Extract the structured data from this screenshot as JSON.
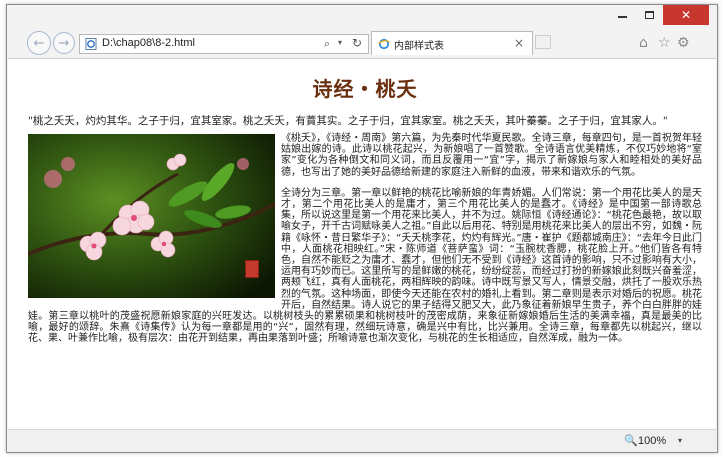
{
  "window": {
    "controls": {
      "minimize": "–",
      "maximize": "□",
      "close": "✕"
    }
  },
  "navigation": {
    "back_icon": "←",
    "forward_icon": "→",
    "address": "D:\\chap08\\8-2.html",
    "search_icon": "⌕",
    "dropdown_icon": "▾",
    "refresh_icon": "↻"
  },
  "tab": {
    "title": "内部样式表",
    "close": "×"
  },
  "toolbar": {
    "home_icon": "⌂",
    "favorites_icon": "☆",
    "settings_icon": "⚙"
  },
  "page": {
    "title": "诗经・桃夭",
    "poem": "\"桃之夭夭，灼灼其华。之子于归，宜其室家。桃之夭夭，有蕡其实。之子于归，宜其家室。桃之夭夭，其叶蓁蓁。之子于归，宜其家人。\"",
    "paragraph1": "《桃夭》，《诗经・周南》第六篇，为先秦时代华夏民歌。全诗三章，每章四句，是一首祝贺年轻姑娘出嫁的诗。此诗以桃花起兴，为新娘唱了一首赞歌。全诗语言优美精炼，不仅巧妙地将“室家”变化为各种倒文和同义词，而且反覆用一“宜”字，揭示了新嫁娘与家人和睦相处的美好品德，也写出了她的美好品德给新建的家庭注入新鲜的血液，带来和谐欢乐的气氛。",
    "paragraph2": "全诗分为三章。第一章以鲜艳的桃花比喻新娘的年青娇媚。人们常说：第一个用花比美人的是天才，第二个用花比美人的是庸才，第三个用花比美人的是蠢才。《诗经》是中国第一部诗歌总集，所以说这里是第一个用花来比美人，并不为过。姚际恒《诗经通论》：“桃花色最艳，故以取喻女子，开千古词赋咏美人之祖。”自此以后用花、特别是用桃花来比美人的层出不穷，如魏・阮籍《咏怀・昔日繁华子》：“夭夭桃李花，灼灼有辉光。”唐・崔护《题都城南庄》：“去年今日此门中，人面桃花相映红。”宋・陈师道《菩萨蛮》词：“玉腕枕香腮，桃花脸上开。”他们皆各有特色，自然不能贬之为庸才、蠢才，但他们无不受到《诗经》这首诗的影响，只不过影响有大小，运用有巧妙而已。这里所写的是鲜嫩的桃花，纷纷绽蕊，而经过打扮的新嫁娘此刻既兴奋羞涩，两颊飞红，真有人面桃花，两相辉映的韵味。诗中既写景又写人，情景交融，烘托了一股欢乐热烈的气氛。这种场面，即使今天还能在农村的婚礼上看到。第二章则是表示对婚后的祝愿。桃花开后，自然结果。诗人说它的果子结得又肥又大，此乃象征着新娘早生贵子，养个白白胖胖的娃娃。第三章以桃叶的茂盛祝愿新娘家庭的兴旺发达。以桃树枝头的累累硕果和桃树枝叶的茂密成荫，来象征新嫁娘婚后生活的美满幸福，真是最美的比喻，最好的颂辞。朱熹《诗集传》认为每一章都是用的“兴”，固然有理，然细玩诗意，确是兴中有比，比兴兼用。全诗三章，每章都先以桃起兴，继以花、果、叶兼作比喻，极有层次：由花开到结果，再由果落到叶盛；所喻诗意也渐次变化，与桃花的生长相适应，自然浑成，融为一体。"
  },
  "status": {
    "zoom_icon": "🔍",
    "zoom_level": "100%",
    "zoom_dropdown": "▾"
  },
  "colors": {
    "title_color": "#6a2e0f",
    "close_button": "#c7372f",
    "link_blue": "#3a6fb5"
  }
}
